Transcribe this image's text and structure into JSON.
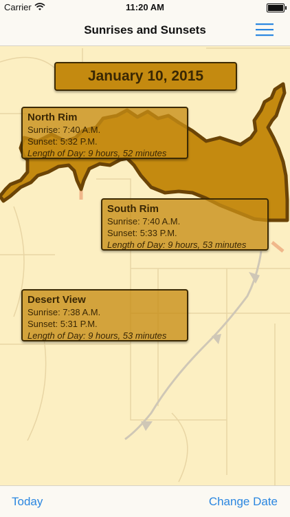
{
  "status_bar": {
    "carrier": "Carrier",
    "time": "11:20 AM"
  },
  "nav": {
    "title": "Sunrises and Sunsets",
    "menu_icon": "hamburger-menu-icon"
  },
  "date_banner": "January 10, 2015",
  "locations": [
    {
      "name": "North Rim",
      "sunrise": "Sunrise: 7:40 A.M.",
      "sunset": "Sunset: 5:32 P.M.",
      "length": "Length of Day: 9 hours, 52 minutes"
    },
    {
      "name": "South Rim",
      "sunrise": "Sunrise: 7:40 A.M.",
      "sunset": "Sunset: 5:33 P.M.",
      "length": "Length of Day: 9 hours, 53 minutes"
    },
    {
      "name": "Desert View",
      "sunrise": "Sunrise: 7:38 A.M.",
      "sunset": "Sunset: 5:31 P.M.",
      "length": "Length of Day: 9 hours, 53 minutes"
    }
  ],
  "toolbar": {
    "today": "Today",
    "change_date": "Change Date"
  },
  "colors": {
    "accent": "#2a86e0",
    "map_bg": "#fcefc2",
    "park_fill": "#c48a10",
    "park_border": "#6b4407"
  }
}
